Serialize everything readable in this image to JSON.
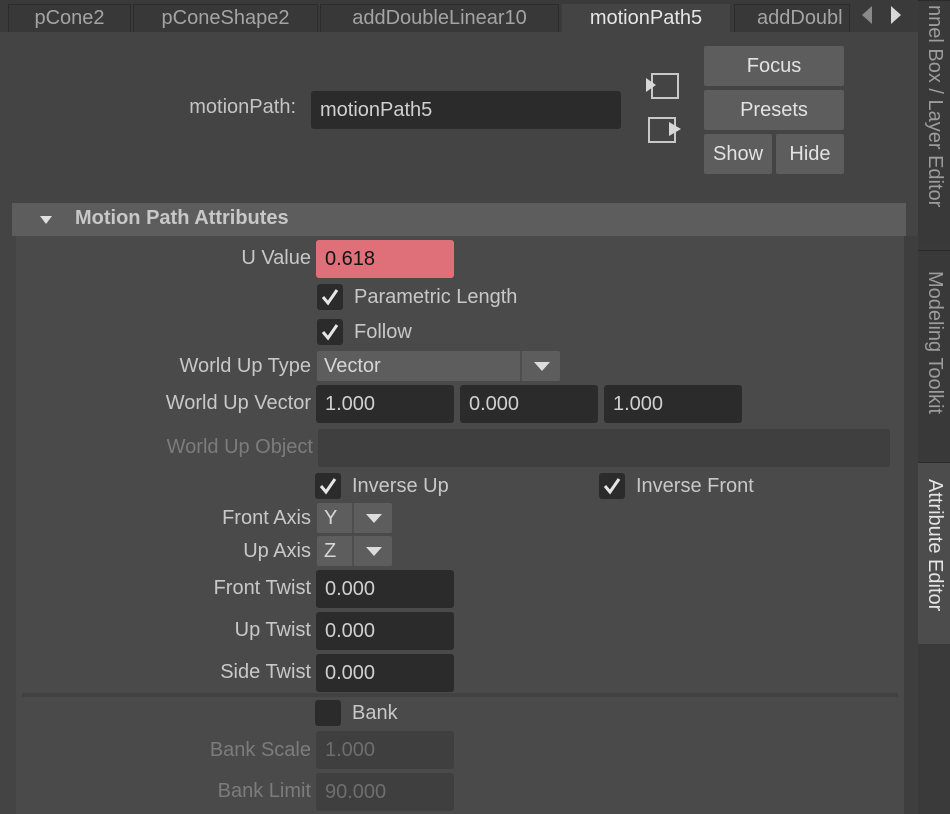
{
  "tabs": [
    {
      "label": "pCone2",
      "active": false
    },
    {
      "label": "pConeShape2",
      "active": false
    },
    {
      "label": "addDoubleLinear10",
      "active": false
    },
    {
      "label": "motionPath5",
      "active": true
    },
    {
      "label": "addDoubl",
      "active": false
    }
  ],
  "header": {
    "node_label": "motionPath:",
    "node_value": "motionPath5",
    "focus_label": "Focus",
    "presets_label": "Presets",
    "show_label": "Show",
    "hide_label": "Hide",
    "icons": [
      "load-input-icon",
      "load-output-icon"
    ]
  },
  "section": {
    "title": "Motion Path Attributes",
    "expanded": true,
    "u_value": {
      "label": "U Value",
      "value": "0.618",
      "highlight_color": "#df707a"
    },
    "parametric_length": {
      "label": "Parametric Length",
      "checked": true
    },
    "follow": {
      "label": "Follow",
      "checked": true
    },
    "world_up_type": {
      "label": "World Up Type",
      "value": "Vector"
    },
    "world_up_vector": {
      "label": "World Up Vector",
      "values": [
        "1.000",
        "0.000",
        "1.000"
      ]
    },
    "world_up_object": {
      "label": "World Up Object",
      "value": ""
    },
    "inverse_up": {
      "label": "Inverse Up",
      "checked": true
    },
    "inverse_front": {
      "label": "Inverse Front",
      "checked": true
    },
    "front_axis": {
      "label": "Front Axis",
      "value": "Y"
    },
    "up_axis": {
      "label": "Up Axis",
      "value": "Z"
    },
    "front_twist": {
      "label": "Front Twist",
      "value": "0.000"
    },
    "up_twist": {
      "label": "Up Twist",
      "value": "0.000"
    },
    "side_twist": {
      "label": "Side Twist",
      "value": "0.000"
    },
    "bank": {
      "label": "Bank",
      "checked": false
    },
    "bank_scale": {
      "label": "Bank Scale",
      "value": "1.000"
    },
    "bank_limit": {
      "label": "Bank Limit",
      "value": "90.000"
    }
  },
  "dock_tabs": [
    {
      "label": "nnel Box / Layer Editor",
      "active": false
    },
    {
      "label": "Modeling Toolkit",
      "active": false
    },
    {
      "label": "Attribute Editor",
      "active": true
    }
  ]
}
